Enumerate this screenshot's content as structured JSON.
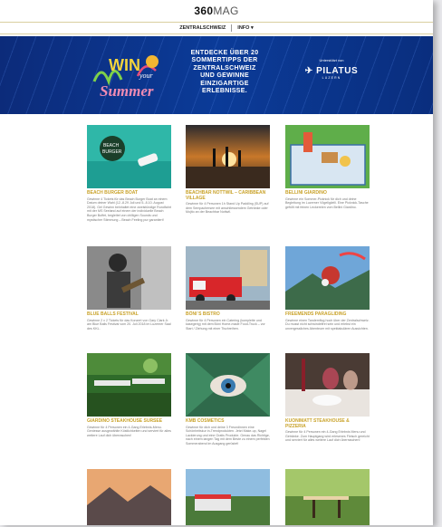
{
  "header": {
    "logo_main": "360",
    "logo_suffix": "MAG"
  },
  "nav": {
    "items": [
      "ZENTRALSCHWEIZ",
      "INFO"
    ],
    "chevron": "chevron-down-icon"
  },
  "banner": {
    "headline": "ENTDECKE ÜBER 20 SOMMERTIPPS DER ZENTRALSCHWEIZ UND GEWINNE EINZIGARTIGE ERLEBNISSE.",
    "sponsor_prefix": "Unterstützt von",
    "sponsor_name": "PILATUS",
    "sponsor_sub": "LUZERN",
    "logo_text_1": "WIN",
    "logo_text_2": "your",
    "logo_text_3": "Summer"
  },
  "colors": {
    "accent": "#c9a229",
    "banner": "#0b3b98"
  },
  "cards": [
    {
      "title": "BEACH BURGER BOAT",
      "desc": "Gewinne 4 Tickets für das Beach Burger Boat an einem Datum deiner Wahl (12.-8.29 Juli und 5.-8.10. August 2018). Gel Gewinn beinhaltet eine zweistündige Rundfahrt mit der MS Seeland auf einem der individuelle Beach Burger Buffet, begleitet von chilligen Sounds und mystischer Stimmung – Beach Feeling pur garantiert!"
    },
    {
      "title": "BEACHBAR NOTTWIL – CARIBBEAN VILLAGE",
      "desc": "Gewinne für 4 Personen 1h Stand Up Paddling (SUP) auf dem Sempachersee mit anschliessendem Getränke oder Mojito an der Beachbar Nottwil."
    },
    {
      "title": "BELLINI GIARDINO",
      "desc": "Gewinne ein Sommer-Picknick für dich und deine Begleitung im Luzerner Vögeligärtli. Eine Picknick-Tasche gefüllt mit feinen Leckereien vom Bellini Giardino."
    },
    {
      "title": "BLUE BALLS FESTIVAL",
      "desc": "Gewinne 2 x 2 Tickets für das Konzert von Gary Clark Jr. am Blue Balls Festival vom 20. Juli 2018 im Luzerner Saal des KKL."
    },
    {
      "title": "BÖNI´S BISTRO",
      "desc": "Gewinne für 4 Personen ein Catering (komplette und kasegerig) mit dem Böni Home-made Food-Truck – vor Start / Ziehung mit einer Tischreihen."
    },
    {
      "title": "FREEMENDS PARAGLIDING",
      "desc": "Gewinne einen Tandemflug hoch über der Zentralschweiz. Du musst nicht schwindelfrei sein und erlebst ein unvergessliches Abenteuer mit spektakulären Aussichten."
    },
    {
      "title": "GIARDINO STEAKHOUSE SURSEE",
      "desc": "Gewinne für 4 Personen ein 4-Gang Erlebnis-Menu. Geniesse ausgewählte Köstlichkeiten und serviert für alles weitere Lauf dich überraschen!"
    },
    {
      "title": "KMB COSMETICS",
      "desc": "Gewinne für dich und deine 3 Freundinnen eine Schönheitskur in-Trendprodukten. Jetzt Make-up, Nagel Lackierung und eine Gratis Produkte. Genau das Richtige, nach einem langen Tag mit dem Beste zu einem perfekten Sommerabend im Ausgang gerüstet!"
    },
    {
      "title": "KUONIMATT STEAKHOUSE & PIZZERIA",
      "desc": "Gewinne für 4 Personen ein 4-Gang Erlebnis Menu und Getränke. Zum Hauptgang wird erlesenes Fleisch gereicht und serviert für alles weitere Lauf dich überraschen!"
    }
  ]
}
